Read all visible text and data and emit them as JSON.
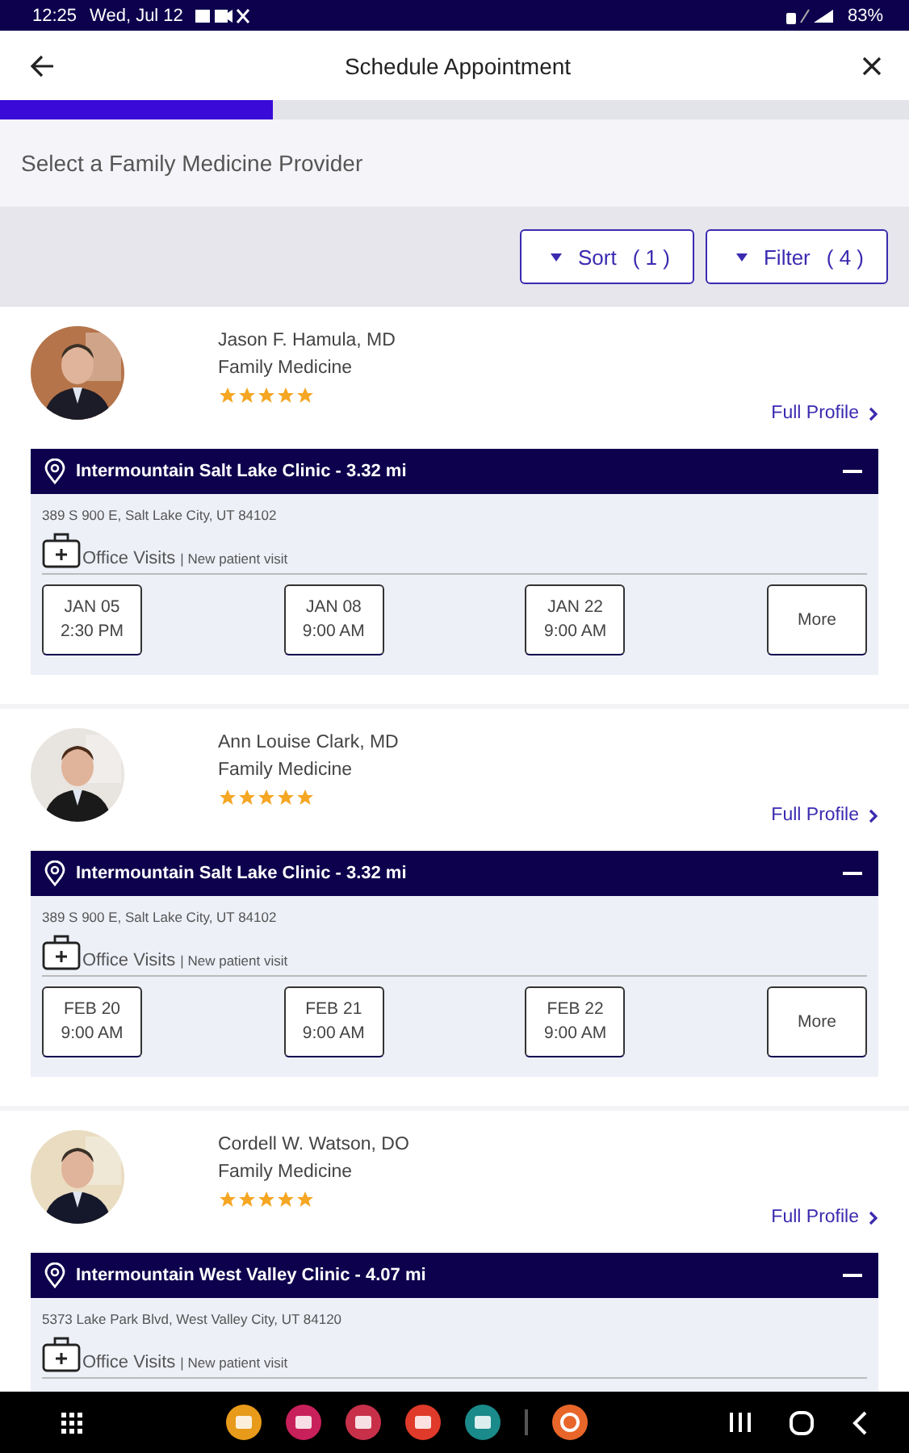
{
  "status_bar": {
    "time": "12:25",
    "date": "Wed, Jul 12",
    "battery": "83%"
  },
  "header": {
    "title": "Schedule Appointment"
  },
  "progress": {
    "level": 0.3
  },
  "subtitle": "Select a Family Medicine Provider",
  "controls": [
    {
      "label": "Sort",
      "count": "( 1 )"
    },
    {
      "label": "Filter",
      "count": "( 4 )"
    }
  ],
  "providers": [
    {
      "name": "Jason F. Hamula, MD",
      "specialty": "Family Medicine",
      "stars": 5,
      "profile_link": "Full Profile",
      "clinic": "Intermountain Salt Lake Clinic - 3.32 mi",
      "expanded": true,
      "address": "389 S 900 E, Salt Lake City, UT 84102",
      "visit_type": "Office Visits",
      "visit_detail": "| New patient visit",
      "slots": [
        {
          "date": "JAN 05",
          "time": "2:30 PM"
        },
        {
          "date": "JAN 08",
          "time": "9:00 AM"
        },
        {
          "date": "JAN 22",
          "time": "9:00 AM"
        }
      ],
      "more": "More"
    },
    {
      "name": "Ann Louise Clark, MD",
      "specialty": "Family Medicine",
      "stars": 5,
      "profile_link": "Full Profile",
      "clinic": "Intermountain Salt Lake Clinic - 3.32 mi",
      "expanded": true,
      "address": "389 S 900 E, Salt Lake City, UT 84102",
      "visit_type": "Office Visits",
      "visit_detail": "| New patient visit",
      "slots": [
        {
          "date": "FEB 20",
          "time": "9:00 AM"
        },
        {
          "date": "FEB 21",
          "time": "9:00 AM"
        },
        {
          "date": "FEB 22",
          "time": "9:00 AM"
        }
      ],
      "more": "More"
    },
    {
      "name": "Cordell W. Watson, DO",
      "specialty": "Family Medicine",
      "stars": 5,
      "profile_link": "Full Profile",
      "clinic": "Intermountain West Valley Clinic - 4.07 mi",
      "expanded": true,
      "address": "5373 Lake Park Blvd, West Valley City, UT 84120",
      "visit_type": "Office Visits",
      "visit_detail": "| New patient visit"
    }
  ]
}
